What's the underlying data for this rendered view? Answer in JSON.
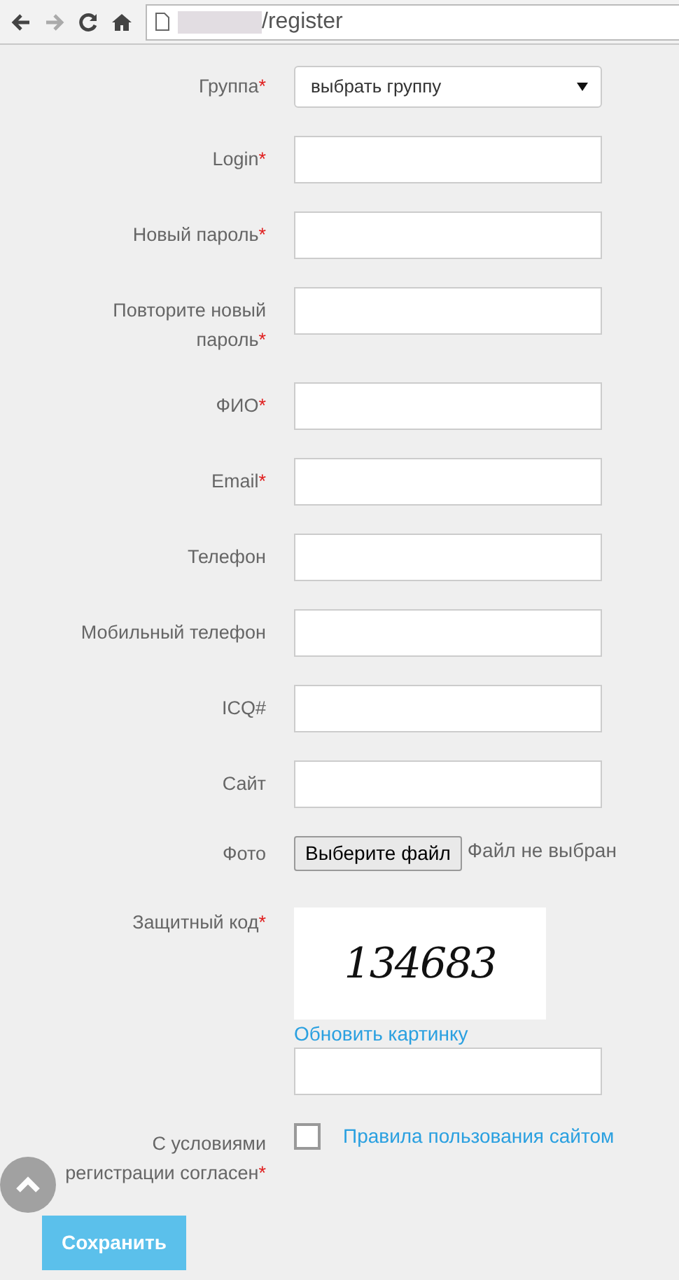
{
  "browser": {
    "url": "/register"
  },
  "fields": [
    {
      "kind": "select",
      "label": "Группа",
      "required_mark": "*",
      "value": "выбрать группу"
    },
    {
      "kind": "text",
      "label": "Login",
      "required_mark": "*"
    },
    {
      "kind": "text",
      "label": "Новый пароль",
      "required_mark": "*"
    },
    {
      "kind": "text",
      "label": "Повторите новый пароль",
      "required_mark": "*"
    },
    {
      "kind": "text",
      "label": "ФИО",
      "required_mark": "*"
    },
    {
      "kind": "text",
      "label": "Email",
      "required_mark": "*"
    },
    {
      "kind": "text",
      "label": "Телефон"
    },
    {
      "kind": "text",
      "label": "Мобильный телефон"
    },
    {
      "kind": "text",
      "label": "ICQ#"
    },
    {
      "kind": "text",
      "label": "Сайт"
    },
    {
      "kind": "file",
      "label": "Фото",
      "button": "Выберите файл",
      "status": "Файл не выбран"
    },
    {
      "kind": "captcha",
      "label": "Защитный код",
      "required_mark": "*",
      "code": "134683",
      "refresh": "Обновить картинку"
    },
    {
      "kind": "agree",
      "label": "С условиями регистрации согласен",
      "required_mark": "*",
      "checked": false,
      "link": "Правила пользования сайтом"
    }
  ],
  "submit": "Сохранить"
}
